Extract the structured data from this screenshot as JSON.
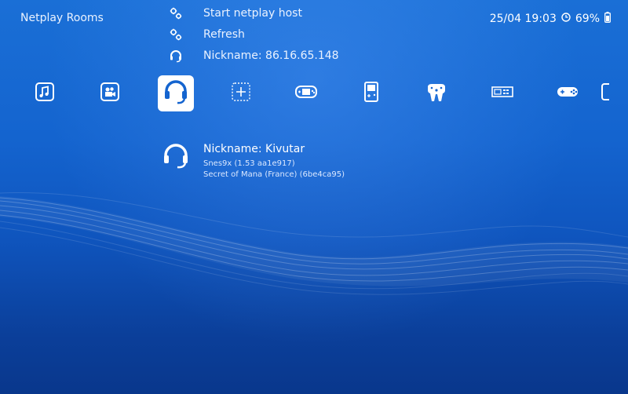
{
  "header": {
    "title": "Netplay Rooms",
    "datetime": "25/04 19:03",
    "battery": "69%"
  },
  "menu": {
    "items": [
      {
        "label": "Start netplay host",
        "icon": "settings-icon"
      },
      {
        "label": "Refresh",
        "icon": "settings-icon"
      },
      {
        "label": "Nickname: 86.16.65.148",
        "icon": "headset-icon"
      }
    ]
  },
  "tabs": [
    {
      "name": "music-icon"
    },
    {
      "name": "video-icon"
    },
    {
      "name": "netplay-headset-icon",
      "active": true
    },
    {
      "name": "add-icon"
    },
    {
      "name": "gba-icon"
    },
    {
      "name": "gameboy-icon"
    },
    {
      "name": "n64-controller-icon"
    },
    {
      "name": "arcade-icon"
    },
    {
      "name": "snes-controller-icon"
    },
    {
      "name": "more-icon"
    }
  ],
  "room": {
    "nickname": "Nickname: Kivutar",
    "core": "Snes9x (1.53 aa1e917)",
    "game": "Secret of Mana (France) (6be4ca95)"
  },
  "colors": {
    "background_top": "#1a6fd6",
    "background_bottom": "#09378c",
    "text": "#ffffff"
  }
}
